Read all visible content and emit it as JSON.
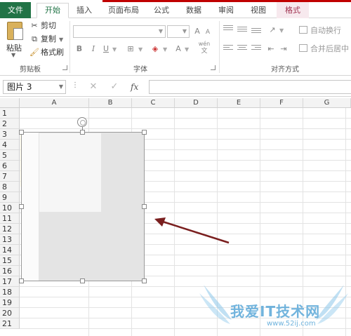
{
  "tabs": {
    "file": "文件",
    "home": "开始",
    "insert": "插入",
    "page_layout": "页面布局",
    "formulas": "公式",
    "data": "数据",
    "review": "审阅",
    "view": "视图",
    "format": "格式"
  },
  "clipboard": {
    "paste": "粘贴",
    "cut": "剪切",
    "copy": "复制",
    "format_painter": "格式刷",
    "group_label": "剪贴板"
  },
  "font": {
    "group_label": "字体",
    "bold": "B",
    "italic": "I",
    "underline": "U",
    "grow": "A",
    "shrink": "A",
    "color_a": "A",
    "wen": "wén"
  },
  "alignment": {
    "wrap_text": "自动换行",
    "merge_center": "合并后居中",
    "group_label": "对齐方式"
  },
  "formula_bar": {
    "name_box": "图片 3",
    "fx": "fx"
  },
  "columns": [
    "A",
    "B",
    "C",
    "D",
    "E",
    "F",
    "G"
  ],
  "rows": [
    "1",
    "2",
    "3",
    "4",
    "5",
    "6",
    "7",
    "8",
    "9",
    "10",
    "11",
    "12",
    "13",
    "14",
    "15",
    "16",
    "17",
    "18",
    "19",
    "20",
    "21"
  ],
  "watermark": {
    "text": "我爱IT技术网",
    "url": "www.52ij.com"
  },
  "colors": {
    "excel_green": "#217346",
    "annotation_arrow": "#7a1f1f",
    "watermark_blue": "#5aa8d8"
  }
}
